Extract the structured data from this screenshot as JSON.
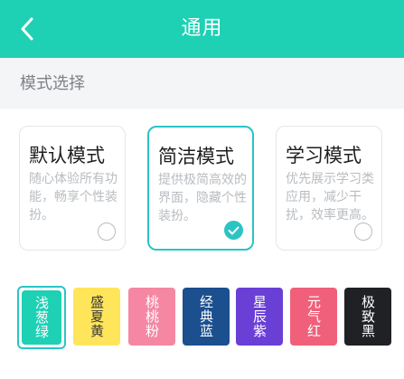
{
  "header": {
    "title": "通用",
    "back_icon": "chevron-left-icon"
  },
  "section": {
    "label": "模式选择"
  },
  "modes": [
    {
      "title": "默认模式",
      "desc": "随心体验所有功能，畅享个性装扮。",
      "selected": false
    },
    {
      "title": "简洁模式",
      "desc": "提供极简高效的界面，隐藏个性装扮。",
      "selected": true
    },
    {
      "title": "学习模式",
      "desc": "优先展示学习类应用，减少干扰，效率更高。",
      "selected": false
    }
  ],
  "themes": [
    {
      "label": "浅葱绿",
      "color": "#1ed0b4",
      "text_color": "#ffffff",
      "selected": true
    },
    {
      "label": "盛夏黄",
      "color": "#ffe55a",
      "text_color": "#3a3a3a",
      "selected": false
    },
    {
      "label": "桃桃粉",
      "color": "#f587a3",
      "text_color": "#ffffff",
      "selected": false
    },
    {
      "label": "经典蓝",
      "color": "#1b4f8e",
      "text_color": "#ffffff",
      "selected": false
    },
    {
      "label": "星辰紫",
      "color": "#6a3fd6",
      "text_color": "#ffffff",
      "selected": false
    },
    {
      "label": "元气红",
      "color": "#f0607a",
      "text_color": "#ffffff",
      "selected": false
    },
    {
      "label": "极致黑",
      "color": "#1f2124",
      "text_color": "#ffffff",
      "selected": false
    }
  ],
  "colors": {
    "accent": "#2bc4c4",
    "header_bg": "#1ed0b4"
  }
}
